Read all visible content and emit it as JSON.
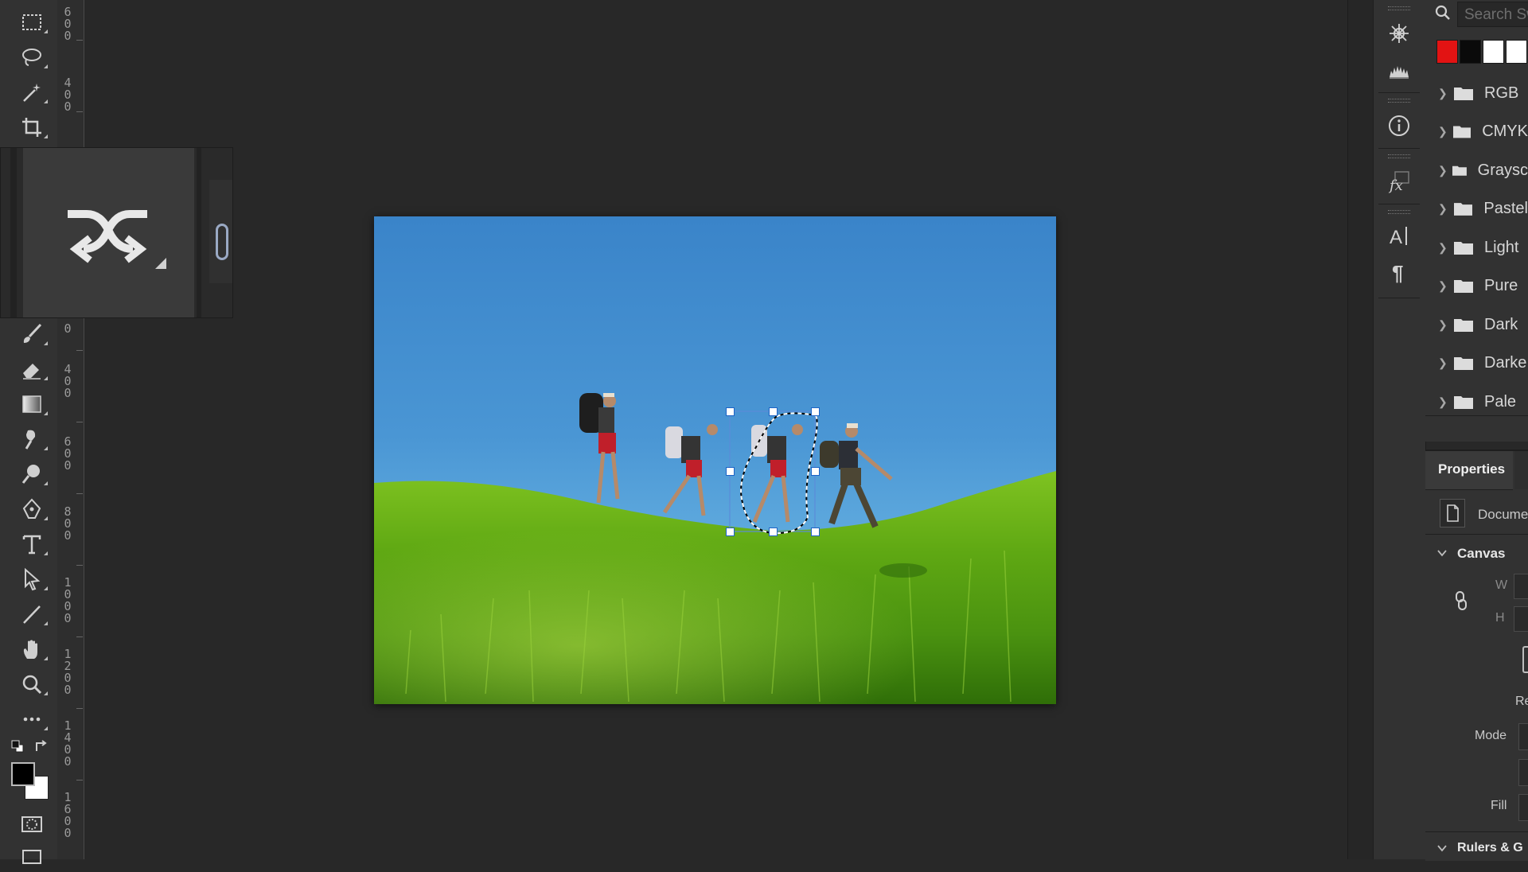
{
  "toolbar": {
    "tools": [
      {
        "icon": "rectangular-marquee-icon"
      },
      {
        "icon": "lasso-icon"
      },
      {
        "icon": "magic-wand-icon"
      },
      {
        "icon": "crop-icon"
      },
      {
        "icon": "brush-icon"
      },
      {
        "icon": "eraser-icon"
      },
      {
        "icon": "gradient-icon"
      },
      {
        "icon": "smudge-icon"
      },
      {
        "icon": "dodge-icon"
      },
      {
        "icon": "pen-icon"
      },
      {
        "icon": "type-icon"
      },
      {
        "icon": "path-selection-icon"
      },
      {
        "icon": "line-icon"
      },
      {
        "icon": "hand-icon"
      },
      {
        "icon": "zoom-icon"
      },
      {
        "icon": "more-tools-icon"
      }
    ],
    "foreground_color": "#000000",
    "background_color": "#ffffff"
  },
  "ruler": {
    "labels": [
      [
        "6",
        "0",
        "0"
      ],
      [
        "4",
        "0",
        "0"
      ],
      [
        "0"
      ],
      [
        "4",
        "0",
        "0"
      ],
      [
        "6",
        "0",
        "0"
      ],
      [
        "8",
        "0",
        "0"
      ],
      [
        "1",
        "0",
        "0",
        "0"
      ],
      [
        "1",
        "2",
        "0",
        "0"
      ],
      [
        "1",
        "4",
        "0",
        "0"
      ],
      [
        "1",
        "6",
        "0",
        "0"
      ]
    ]
  },
  "overlay": {
    "icon": "shuffle-arrows-icon"
  },
  "side_icons": [
    "compass-icon",
    "histogram-icon",
    "info-icon",
    "fx-icon",
    "character-icon",
    "paragraph-icon"
  ],
  "swatches": {
    "search_placeholder": "Search Sw",
    "colors": [
      "#e21313",
      "#0a0a0a",
      "#ffffff",
      "#ffffff"
    ],
    "folders": [
      "RGB",
      "CMYK",
      "Graysc",
      "Pastel",
      "Light",
      "Pure",
      "Dark",
      "Darke",
      "Pale"
    ]
  },
  "properties": {
    "tab": "Properties",
    "doc_label": "Docume",
    "canvas_section": "Canvas",
    "w_label": "W",
    "h_label": "H",
    "re_label": "Re",
    "mode_label": "Mode",
    "fill_label": "Fill",
    "rulers_section": "Rulers & G"
  },
  "colors": {
    "app_bg": "#282828",
    "panel_bg": "#323232",
    "selection_handle": "#1c63c6"
  }
}
